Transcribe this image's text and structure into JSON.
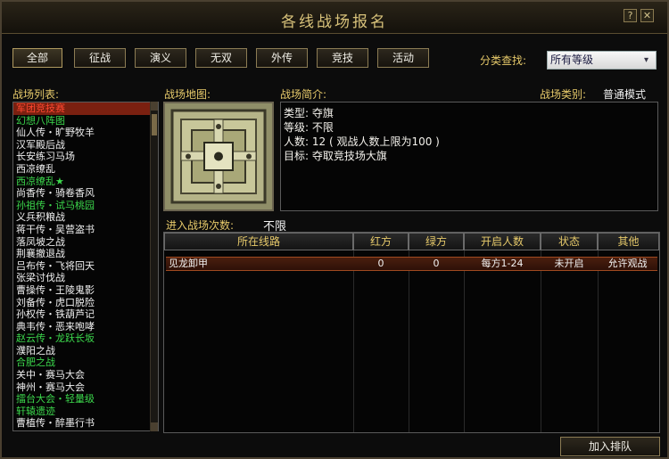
{
  "window": {
    "title": "各线战场报名",
    "help_label": "?",
    "close_label": "✕"
  },
  "filters": {
    "buttons": [
      "全部",
      "征战",
      "演义",
      "无双",
      "外传",
      "竞技",
      "活动"
    ],
    "search_label": "分类查找:",
    "select_value": "所有等级",
    "select_arrow": "▾"
  },
  "list": {
    "label": "战场列表:",
    "items": [
      {
        "text": "军团竞技赛",
        "style": "sel"
      },
      {
        "text": "幻想八阵图",
        "style": "green"
      },
      {
        "text": "仙人传・旷野牧羊",
        "style": "white"
      },
      {
        "text": "汉军殿后战",
        "style": "white"
      },
      {
        "text": "长安练习马场",
        "style": "white"
      },
      {
        "text": "西凉缭乱",
        "style": "white"
      },
      {
        "text": "西凉缭乱★",
        "style": "green"
      },
      {
        "text": "尚香传・骑卷香风",
        "style": "white"
      },
      {
        "text": "孙祖传・试马桃园",
        "style": "green"
      },
      {
        "text": "义兵积粮战",
        "style": "white"
      },
      {
        "text": "蒋干传・吴营盗书",
        "style": "white"
      },
      {
        "text": "落凤坡之战",
        "style": "white"
      },
      {
        "text": "荆襄撤退战",
        "style": "white"
      },
      {
        "text": "吕布传・飞将回天",
        "style": "white"
      },
      {
        "text": "张梁讨伐战",
        "style": "white"
      },
      {
        "text": "曹操传・王陵鬼影",
        "style": "white"
      },
      {
        "text": "刘备传・虎口脱险",
        "style": "white"
      },
      {
        "text": "孙权传・铁葫芦记",
        "style": "white"
      },
      {
        "text": "典韦传・恶来咆哮",
        "style": "white"
      },
      {
        "text": "赵云传・龙跃长坂",
        "style": "green"
      },
      {
        "text": "濮阳之战",
        "style": "white"
      },
      {
        "text": "合肥之战",
        "style": "green"
      },
      {
        "text": "关中・赛马大会",
        "style": "white"
      },
      {
        "text": "神州・赛马大会",
        "style": "white"
      },
      {
        "text": "擂台大会・轻量级",
        "style": "green"
      },
      {
        "text": "轩辕遗迹",
        "style": "green"
      },
      {
        "text": "曹植传・醉墨行书",
        "style": "white"
      }
    ]
  },
  "map": {
    "label": "战场地图:"
  },
  "intro": {
    "label": "战场简介:",
    "lines": [
      "类型: 夺旗",
      "等级: 不限",
      "人数: 12 ( 观战人数上限为100 )",
      "目标: 夺取竞技场大旗"
    ]
  },
  "mode": {
    "label": "战场类别:",
    "value": "普通模式"
  },
  "entries": {
    "label": "进入战场次数:",
    "value": "不限"
  },
  "table": {
    "headers": [
      "所在线路",
      "红方",
      "绿方",
      "开启人数",
      "状态",
      "其他"
    ],
    "rows": [
      [
        "见龙卸甲",
        "0",
        "0",
        "每方1-24",
        "未开启",
        "允许观战"
      ]
    ]
  },
  "join_label": "加入排队"
}
